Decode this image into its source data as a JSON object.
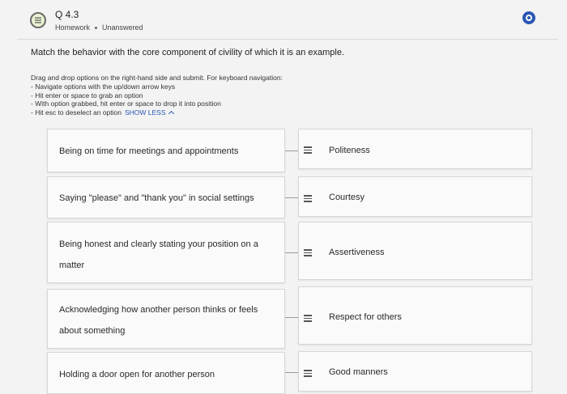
{
  "header": {
    "title": "Q 4.3",
    "type": "Homework",
    "status": "Unanswered"
  },
  "prompt": "Match the behavior with the core component of civility of which it is an example.",
  "instructions": {
    "intro": "Drag and drop options on the right-hand side and submit. For keyboard navigation:",
    "steps": [
      "- Navigate options with the up/down arrow keys",
      "- Hit enter or space to grab an option",
      "- With option grabbed, hit enter or space to drop it into position",
      "- Hit esc to deselect an option"
    ],
    "toggle_label": "SHOW LESS"
  },
  "pairs": [
    {
      "behavior": "Being on time for meetings and appointments",
      "component": "Politeness"
    },
    {
      "behavior": "Saying \"please\" and \"thank you\" in social settings",
      "component": "Courtesy"
    },
    {
      "behavior_lines": [
        "Being honest and clearly stating your position on a",
        "matter"
      ],
      "component": "Assertiveness"
    },
    {
      "behavior_lines": [
        "Acknowledging how another person thinks or feels",
        "about something"
      ],
      "component": "Respect for others"
    },
    {
      "behavior": "Holding a door open for another person",
      "component": "Good manners"
    }
  ]
}
